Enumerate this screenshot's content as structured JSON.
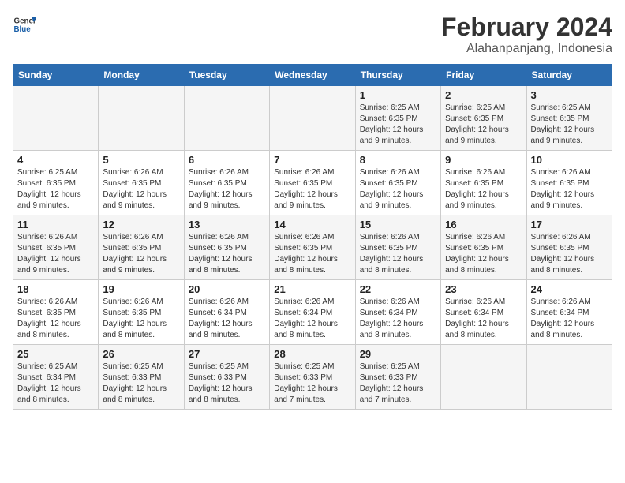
{
  "logo": {
    "line1": "General",
    "line2": "Blue"
  },
  "title": "February 2024",
  "subtitle": "Alahanpanjang, Indonesia",
  "days_of_week": [
    "Sunday",
    "Monday",
    "Tuesday",
    "Wednesday",
    "Thursday",
    "Friday",
    "Saturday"
  ],
  "weeks": [
    [
      {
        "day": "",
        "info": ""
      },
      {
        "day": "",
        "info": ""
      },
      {
        "day": "",
        "info": ""
      },
      {
        "day": "",
        "info": ""
      },
      {
        "day": "1",
        "info": "Sunrise: 6:25 AM\nSunset: 6:35 PM\nDaylight: 12 hours\nand 9 minutes."
      },
      {
        "day": "2",
        "info": "Sunrise: 6:25 AM\nSunset: 6:35 PM\nDaylight: 12 hours\nand 9 minutes."
      },
      {
        "day": "3",
        "info": "Sunrise: 6:25 AM\nSunset: 6:35 PM\nDaylight: 12 hours\nand 9 minutes."
      }
    ],
    [
      {
        "day": "4",
        "info": "Sunrise: 6:25 AM\nSunset: 6:35 PM\nDaylight: 12 hours\nand 9 minutes."
      },
      {
        "day": "5",
        "info": "Sunrise: 6:26 AM\nSunset: 6:35 PM\nDaylight: 12 hours\nand 9 minutes."
      },
      {
        "day": "6",
        "info": "Sunrise: 6:26 AM\nSunset: 6:35 PM\nDaylight: 12 hours\nand 9 minutes."
      },
      {
        "day": "7",
        "info": "Sunrise: 6:26 AM\nSunset: 6:35 PM\nDaylight: 12 hours\nand 9 minutes."
      },
      {
        "day": "8",
        "info": "Sunrise: 6:26 AM\nSunset: 6:35 PM\nDaylight: 12 hours\nand 9 minutes."
      },
      {
        "day": "9",
        "info": "Sunrise: 6:26 AM\nSunset: 6:35 PM\nDaylight: 12 hours\nand 9 minutes."
      },
      {
        "day": "10",
        "info": "Sunrise: 6:26 AM\nSunset: 6:35 PM\nDaylight: 12 hours\nand 9 minutes."
      }
    ],
    [
      {
        "day": "11",
        "info": "Sunrise: 6:26 AM\nSunset: 6:35 PM\nDaylight: 12 hours\nand 9 minutes."
      },
      {
        "day": "12",
        "info": "Sunrise: 6:26 AM\nSunset: 6:35 PM\nDaylight: 12 hours\nand 9 minutes."
      },
      {
        "day": "13",
        "info": "Sunrise: 6:26 AM\nSunset: 6:35 PM\nDaylight: 12 hours\nand 8 minutes."
      },
      {
        "day": "14",
        "info": "Sunrise: 6:26 AM\nSunset: 6:35 PM\nDaylight: 12 hours\nand 8 minutes."
      },
      {
        "day": "15",
        "info": "Sunrise: 6:26 AM\nSunset: 6:35 PM\nDaylight: 12 hours\nand 8 minutes."
      },
      {
        "day": "16",
        "info": "Sunrise: 6:26 AM\nSunset: 6:35 PM\nDaylight: 12 hours\nand 8 minutes."
      },
      {
        "day": "17",
        "info": "Sunrise: 6:26 AM\nSunset: 6:35 PM\nDaylight: 12 hours\nand 8 minutes."
      }
    ],
    [
      {
        "day": "18",
        "info": "Sunrise: 6:26 AM\nSunset: 6:35 PM\nDaylight: 12 hours\nand 8 minutes."
      },
      {
        "day": "19",
        "info": "Sunrise: 6:26 AM\nSunset: 6:35 PM\nDaylight: 12 hours\nand 8 minutes."
      },
      {
        "day": "20",
        "info": "Sunrise: 6:26 AM\nSunset: 6:34 PM\nDaylight: 12 hours\nand 8 minutes."
      },
      {
        "day": "21",
        "info": "Sunrise: 6:26 AM\nSunset: 6:34 PM\nDaylight: 12 hours\nand 8 minutes."
      },
      {
        "day": "22",
        "info": "Sunrise: 6:26 AM\nSunset: 6:34 PM\nDaylight: 12 hours\nand 8 minutes."
      },
      {
        "day": "23",
        "info": "Sunrise: 6:26 AM\nSunset: 6:34 PM\nDaylight: 12 hours\nand 8 minutes."
      },
      {
        "day": "24",
        "info": "Sunrise: 6:26 AM\nSunset: 6:34 PM\nDaylight: 12 hours\nand 8 minutes."
      }
    ],
    [
      {
        "day": "25",
        "info": "Sunrise: 6:25 AM\nSunset: 6:34 PM\nDaylight: 12 hours\nand 8 minutes."
      },
      {
        "day": "26",
        "info": "Sunrise: 6:25 AM\nSunset: 6:33 PM\nDaylight: 12 hours\nand 8 minutes."
      },
      {
        "day": "27",
        "info": "Sunrise: 6:25 AM\nSunset: 6:33 PM\nDaylight: 12 hours\nand 8 minutes."
      },
      {
        "day": "28",
        "info": "Sunrise: 6:25 AM\nSunset: 6:33 PM\nDaylight: 12 hours\nand 7 minutes."
      },
      {
        "day": "29",
        "info": "Sunrise: 6:25 AM\nSunset: 6:33 PM\nDaylight: 12 hours\nand 7 minutes."
      },
      {
        "day": "",
        "info": ""
      },
      {
        "day": "",
        "info": ""
      }
    ]
  ]
}
